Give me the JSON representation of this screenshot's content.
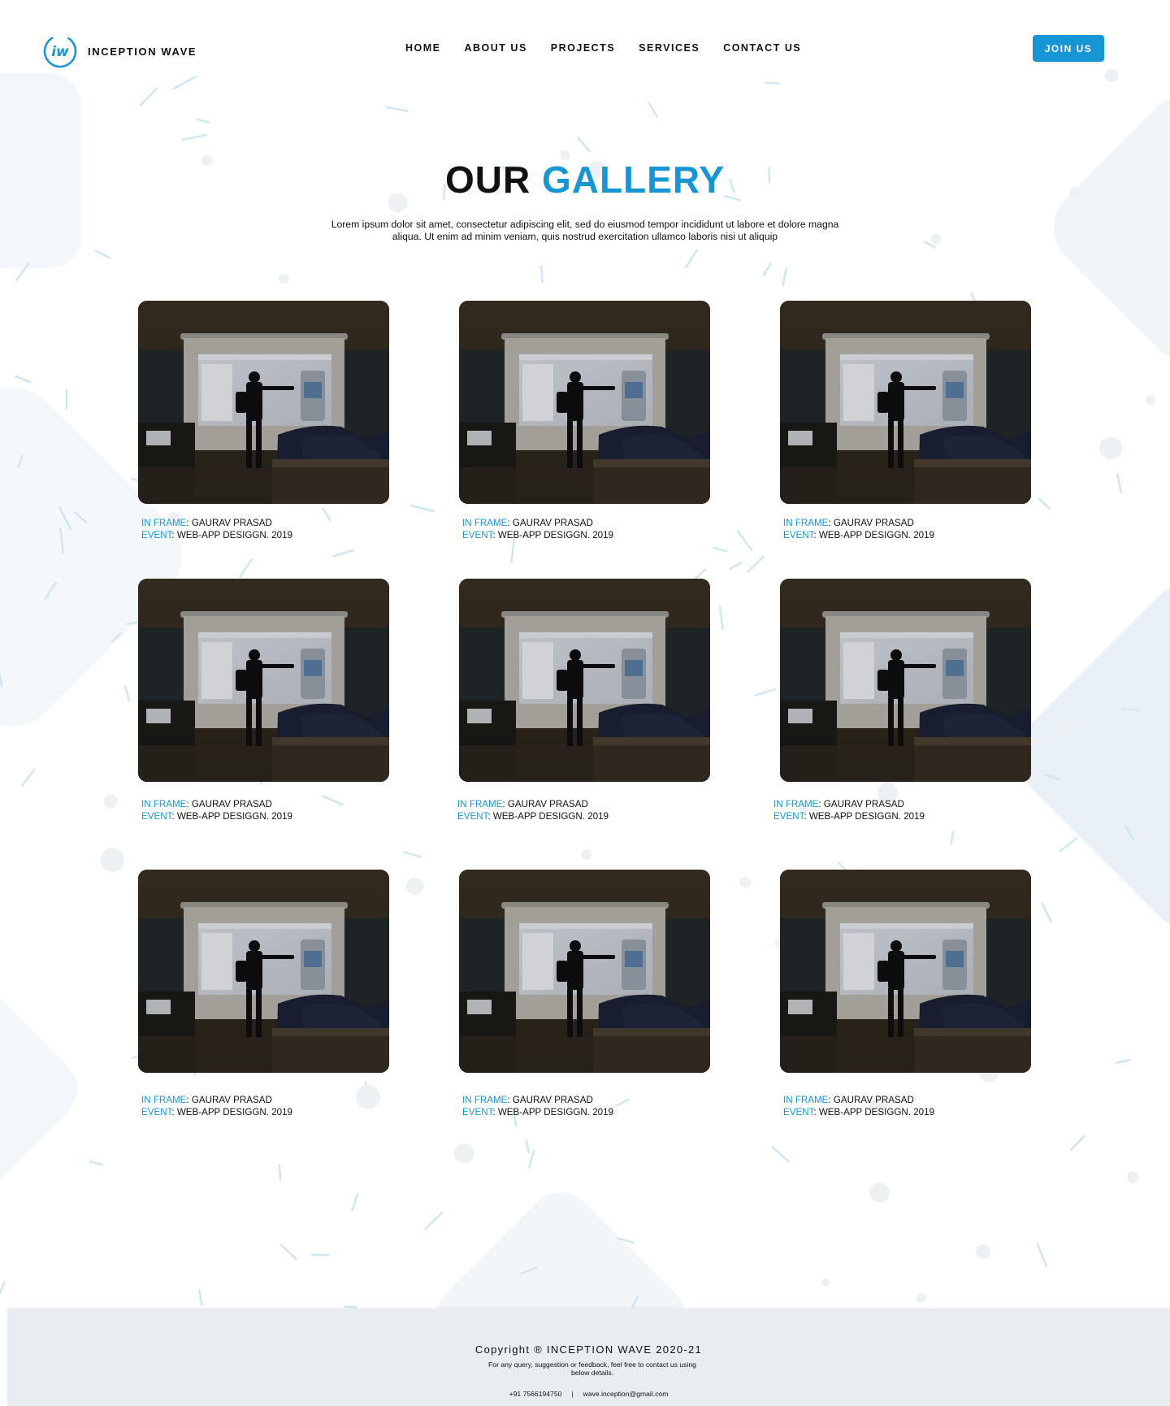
{
  "brand": {
    "name": "INCEPTION WAVE",
    "accent_color": "#1796d6",
    "logo_icon": "iw-circle-logo"
  },
  "nav": {
    "items": [
      "HOME",
      "ABOUT US",
      "PROJECTS",
      "SERVICES",
      "CONTACT US"
    ],
    "cta_label": "JOIN US"
  },
  "hero": {
    "title_plain": "OUR",
    "title_accent": "GALLERY",
    "description": "Lorem ipsum dolor sit amet, consectetur adipiscing elit, sed do eiusmod tempor incididunt ut labore et dolore magna aliqua. Ut enim ad minim veniam, quis nostrud exercitation ullamco laboris nisi ut aliquip"
  },
  "gallery": {
    "items": [
      {
        "frame_label": "IN FRAME",
        "frame_value": ": GAURAV PRASAD",
        "event_label": "EVENT",
        "event_value": ": WEB-APP DESIGGN. 2019"
      },
      {
        "frame_label": "IN FRAME",
        "frame_value": ": GAURAV PRASAD",
        "event_label": "EVENT",
        "event_value": ": WEB-APP DESIGGN. 2019"
      },
      {
        "frame_label": "IN FRAME",
        "frame_value": ": GAURAV PRASAD",
        "event_label": "EVENT",
        "event_value": ": WEB-APP DESIGGN. 2019"
      },
      {
        "frame_label": "IN FRAME",
        "frame_value": ": GAURAV PRASAD",
        "event_label": "EVENT",
        "event_value": ": WEB-APP DESIGGN. 2019"
      },
      {
        "frame_label": "IN FRAME",
        "frame_value": ": GAURAV PRASAD",
        "event_label": "EVENT",
        "event_value": ": WEB-APP DESIGGN. 2019"
      },
      {
        "frame_label": "IN FRAME",
        "frame_value": ": GAURAV PRASAD",
        "event_label": "EVENT",
        "event_value": ": WEB-APP DESIGGN. 2019"
      },
      {
        "frame_label": "IN FRAME",
        "frame_value": ": GAURAV PRASAD",
        "event_label": "EVENT",
        "event_value": ": WEB-APP DESIGGN. 2019"
      },
      {
        "frame_label": "IN FRAME",
        "frame_value": ": GAURAV PRASAD",
        "event_label": "EVENT",
        "event_value": ": WEB-APP DESIGGN. 2019"
      },
      {
        "frame_label": "IN FRAME",
        "frame_value": ": GAURAV PRASAD",
        "event_label": "EVENT",
        "event_value": ": WEB-APP DESIGGN. 2019"
      }
    ]
  },
  "footer": {
    "copyright": "Copyright ® INCEPTION WAVE 2020-21",
    "note": "For any query, suggestion or feedback, feel free to contact us using below details.",
    "phone": "+91 7566194750",
    "separator": "|",
    "email": "wave.inception@gmail.com"
  }
}
